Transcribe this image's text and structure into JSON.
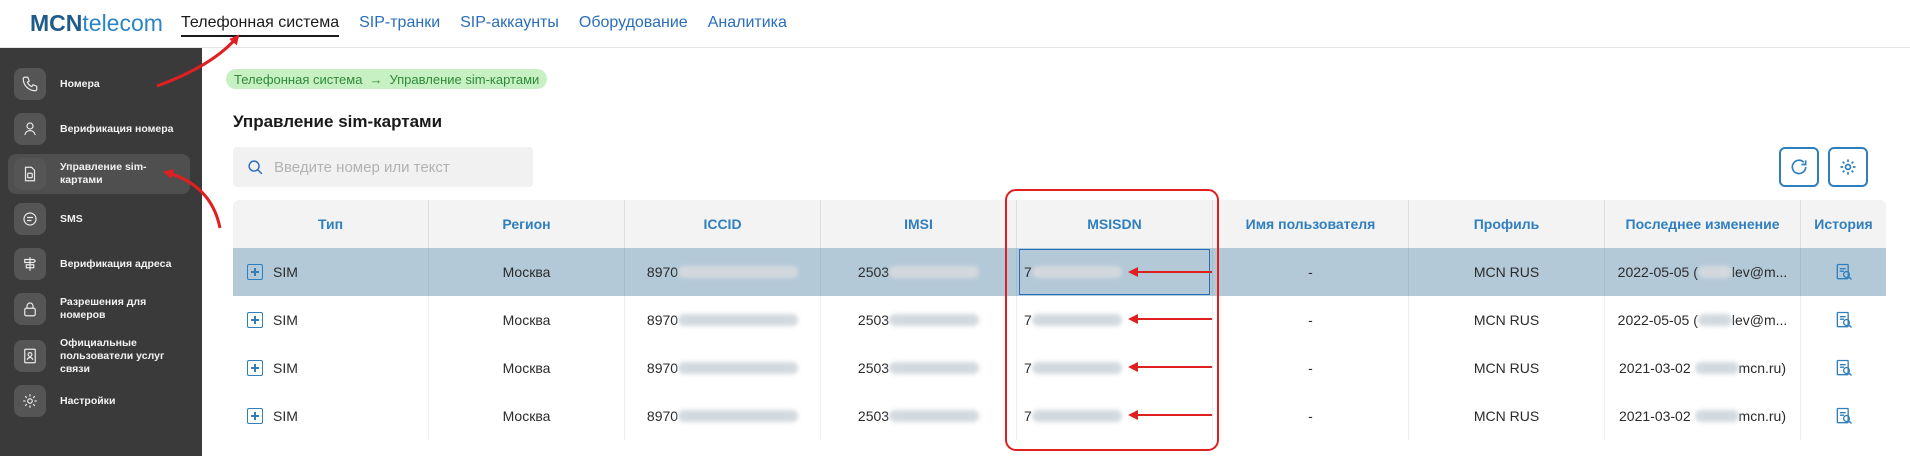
{
  "logo": {
    "part1": "MCN",
    "part2": "telecom"
  },
  "nav": {
    "tabs": [
      {
        "label": "Телефонная система",
        "active": true
      },
      {
        "label": "SIP-транки"
      },
      {
        "label": "SIP-аккаунты"
      },
      {
        "label": "Оборудование"
      },
      {
        "label": "Аналитика"
      }
    ]
  },
  "sidebar": {
    "items": [
      {
        "label": "Номера",
        "icon": "phone-icon"
      },
      {
        "label": "Верификация номера",
        "icon": "verify-number-icon"
      },
      {
        "label": "Управление sim-картами",
        "icon": "sim-card-icon",
        "active": true
      },
      {
        "label": "SMS",
        "icon": "sms-icon"
      },
      {
        "label": "Верификация адреса",
        "icon": "address-sign-icon"
      },
      {
        "label": "Разрешения для номеров",
        "icon": "lock-icon"
      },
      {
        "label": "Официальные пользователи услуг связи",
        "icon": "users-document-icon"
      },
      {
        "label": "Настройки",
        "icon": "gear-icon"
      }
    ]
  },
  "breadcrumb": {
    "root": "Телефонная система",
    "arrow": "→",
    "current": "Управление sim-картами"
  },
  "page": {
    "title": "Управление sim-картами"
  },
  "search": {
    "placeholder": "Введите номер или текст",
    "value": ""
  },
  "table": {
    "columns": [
      "Тип",
      "Регион",
      "ICCID",
      "IMSI",
      "MSISDN",
      "Имя пользователя",
      "Профиль",
      "Последнее изменение",
      "История"
    ],
    "rows": [
      {
        "type": "SIM",
        "region": "Москва",
        "iccid": "8970",
        "imsi": "2503",
        "msisdn": "7",
        "user": "-",
        "profile": "MCN RUS",
        "changed_date": "2022-05-05",
        "changed_pre": "(",
        "changed_post": "lev@m...",
        "selected": true
      },
      {
        "type": "SIM",
        "region": "Москва",
        "iccid": "8970",
        "imsi": "2503",
        "msisdn": "7",
        "user": "-",
        "profile": "MCN RUS",
        "changed_date": "2022-05-05",
        "changed_pre": "(",
        "changed_post": "lev@m..."
      },
      {
        "type": "SIM",
        "region": "Москва",
        "iccid": "8970",
        "imsi": "2503",
        "msisdn": "7",
        "user": "-",
        "profile": "MCN RUS",
        "changed_date": "2021-03-02",
        "changed_pre": "",
        "changed_post": "mcn.ru)"
      },
      {
        "type": "SIM",
        "region": "Москва",
        "iccid": "8970",
        "imsi": "2503",
        "msisdn": "7",
        "user": "-",
        "profile": "MCN RUS",
        "changed_date": "2021-03-02",
        "changed_pre": "",
        "changed_post": "mcn.ru)"
      }
    ]
  },
  "colors": {
    "accent": "#2f7fbf",
    "sidebar_bg": "#3a3a3a",
    "selected_row": "#b4c9d8",
    "breadcrumb_bg": "#c7f0c3",
    "annotation": "#e02020"
  }
}
